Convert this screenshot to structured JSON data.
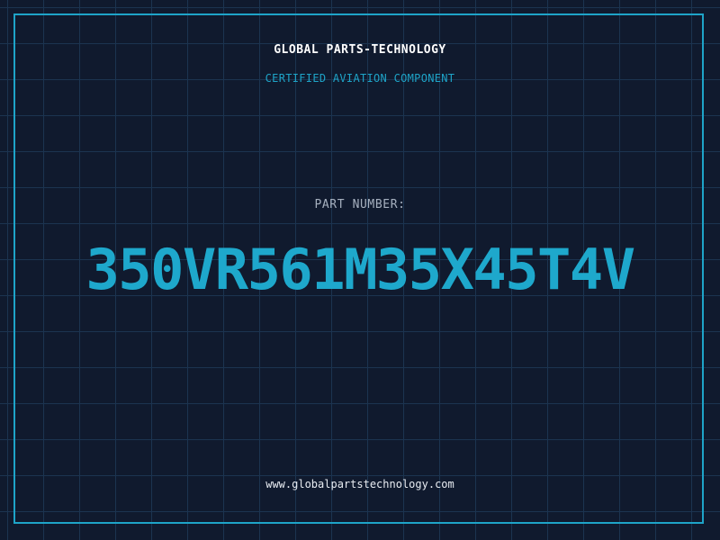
{
  "header": {
    "company": "GLOBAL PARTS-TECHNOLOGY",
    "subtitle": "CERTIFIED AVIATION COMPONENT"
  },
  "part": {
    "label": "PART NUMBER:",
    "number": "350VR561M35X45T4V"
  },
  "footer": {
    "website": "www.globalpartstechnology.com"
  },
  "colors": {
    "background": "#101a2e",
    "grid": "#1c3450",
    "accent": "#1ea4c8"
  }
}
